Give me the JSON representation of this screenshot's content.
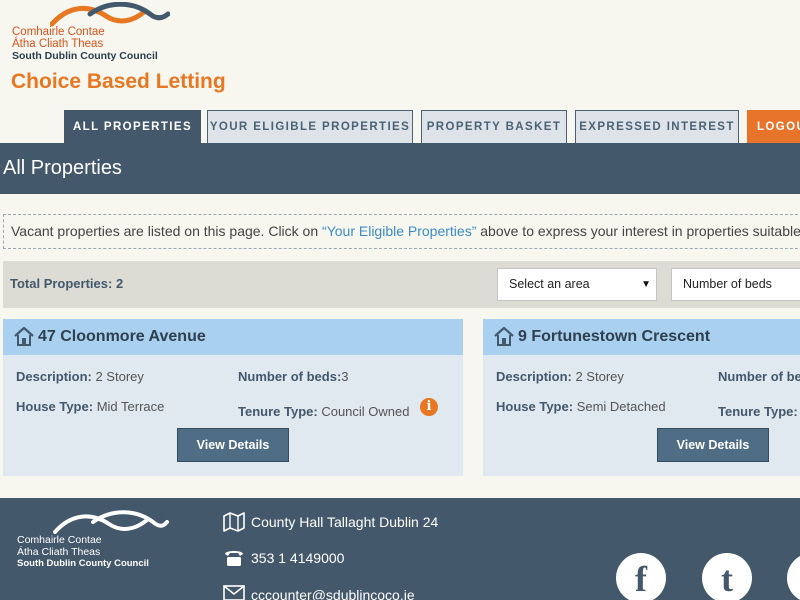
{
  "logo": {
    "line1": "Comhairle Contae",
    "line2": "Átha Cliath Theas",
    "line3": "South Dublin County Council"
  },
  "site_title": "Choice Based Letting",
  "nav": {
    "tabs": [
      {
        "label": "ALL PROPERTIES"
      },
      {
        "label": "YOUR ELIGIBLE PROPERTIES"
      },
      {
        "label": "PROPERTY BASKET"
      },
      {
        "label": "EXPRESSED INTEREST"
      },
      {
        "label": "LOGOUT"
      }
    ]
  },
  "page_title": "All Properties",
  "notice": {
    "before": "Vacant properties are listed on this page. Click on ",
    "link": "“Your Eligible Properties”",
    "after": " above to express your interest in properties suitable to you."
  },
  "filters": {
    "total": "Total Properties: 2",
    "area_select": "Select an area",
    "beds_select": "Number of beds"
  },
  "properties": [
    {
      "title": "47 Cloonmore Avenue",
      "description_label": "Description:",
      "description": "2 Storey",
      "beds_label": "Number of beds:",
      "beds": "3",
      "house_type_label": "House Type:",
      "house_type": "Mid Terrace",
      "tenure_label": "Tenure Type:",
      "tenure": "Council Owned",
      "button": "View Details"
    },
    {
      "title": "9 Fortunestown Crescent",
      "description_label": "Description:",
      "description": "2 Storey",
      "beds_label": "Number of beds:",
      "beds": "",
      "house_type_label": "House Type:",
      "house_type": "Semi Detached",
      "tenure_label": "Tenure Type:",
      "tenure": "",
      "button": "View Details"
    }
  ],
  "footer": {
    "address": "County Hall Tallaght Dublin 24",
    "phone": "353 1 4149000",
    "email": "cccounter@sdublincoco.ie"
  },
  "colors": {
    "navy": "#43586b",
    "orange": "#e87722",
    "card_header": "#a9d0ef",
    "card_body": "#e0e8f0"
  },
  "icons": [
    "home-icon",
    "info-icon",
    "map-icon",
    "phone-icon",
    "mail-icon",
    "facebook-icon",
    "twitter-icon"
  ]
}
